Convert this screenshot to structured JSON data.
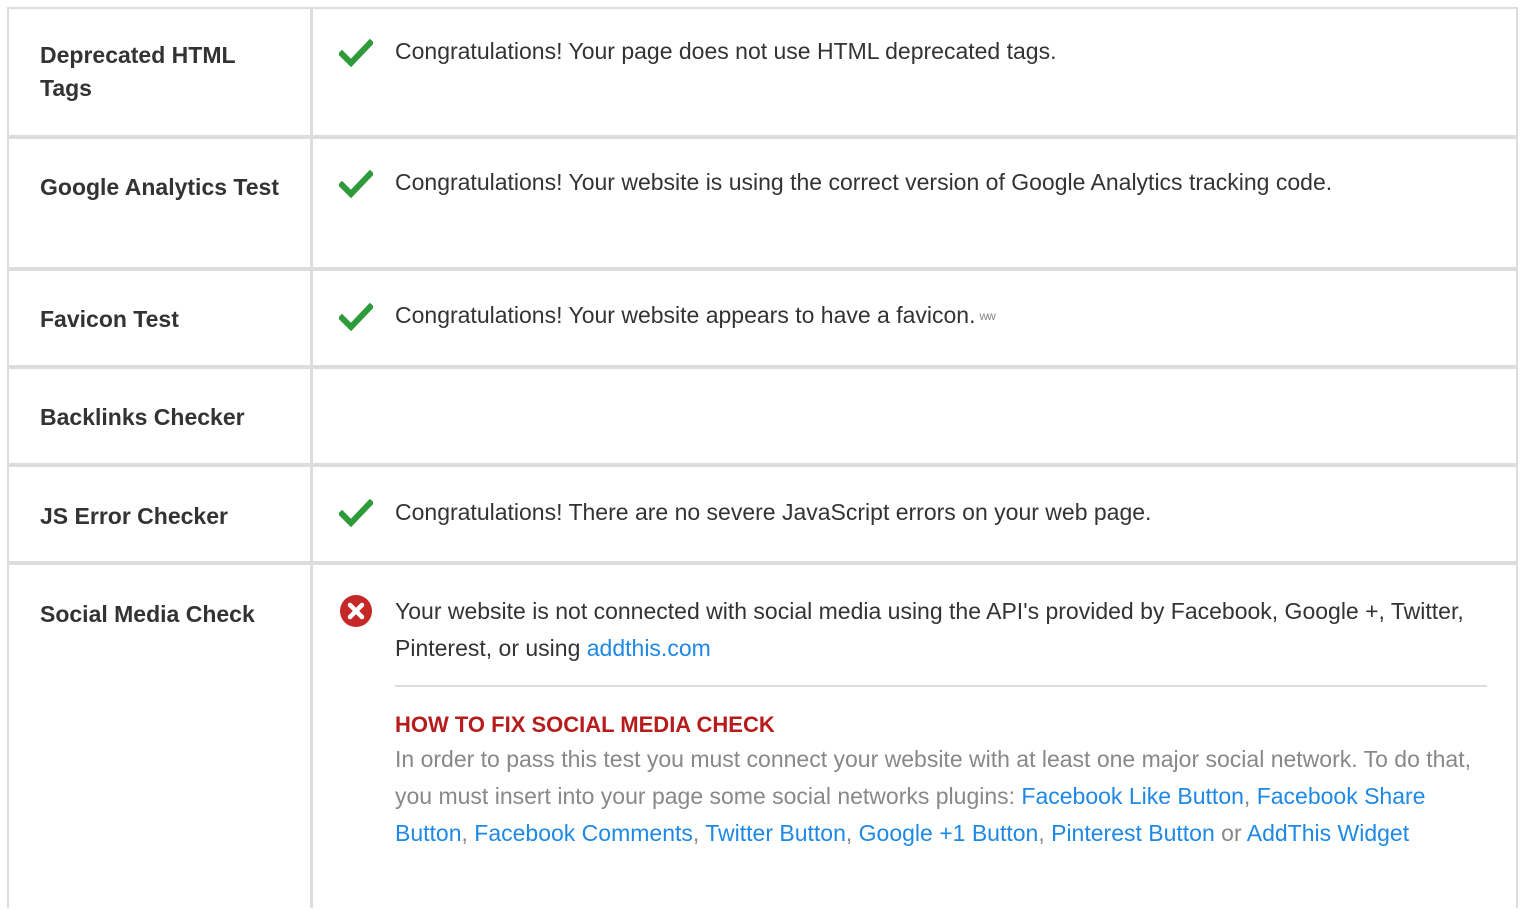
{
  "rows": [
    {
      "label": "Deprecated HTML Tags",
      "status": "pass",
      "message": "Congratulations! Your page does not use HTML deprecated tags."
    },
    {
      "label": "Google Analytics Test",
      "status": "pass",
      "message": "Congratulations! Your website is using the correct version of Google Analytics tracking code."
    },
    {
      "label": "Favicon Test",
      "status": "pass",
      "message": "Congratulations! Your website appears to have a favicon.",
      "favicon_glyph": "ww"
    },
    {
      "label": "Backlinks Checker",
      "status": "none",
      "message": ""
    },
    {
      "label": "JS Error Checker",
      "status": "pass",
      "message": "Congratulations! There are no severe JavaScript errors on your web page."
    },
    {
      "label": "Social Media Check",
      "status": "fail",
      "message_part1": "Your website is not connected with social media using the API's provided by Facebook, Google +, Twitter, Pinterest, or using",
      "message_link": "addthis.com",
      "fix_title": "HOW TO FIX SOCIAL MEDIA CHECK",
      "fix_text": "In order to pass this test you must connect your website with at least one major social network. To do that, you must insert into your page some social networks plugins:",
      "fix_links": [
        "Facebook Like Button",
        "Facebook Share Button",
        "Facebook Comments",
        "Twitter Button",
        "Google +1 Button",
        "Pinterest Button"
      ],
      "fix_or": "or",
      "fix_last_link": "AddThis Widget"
    }
  ],
  "icons": {
    "pass": "check-icon",
    "fail": "error-circle-icon"
  },
  "colors": {
    "pass": "#2e9a3a",
    "fail": "#c62828",
    "link": "#1e88e5",
    "fix_title": "#b71c1c",
    "border": "#dddddd"
  }
}
